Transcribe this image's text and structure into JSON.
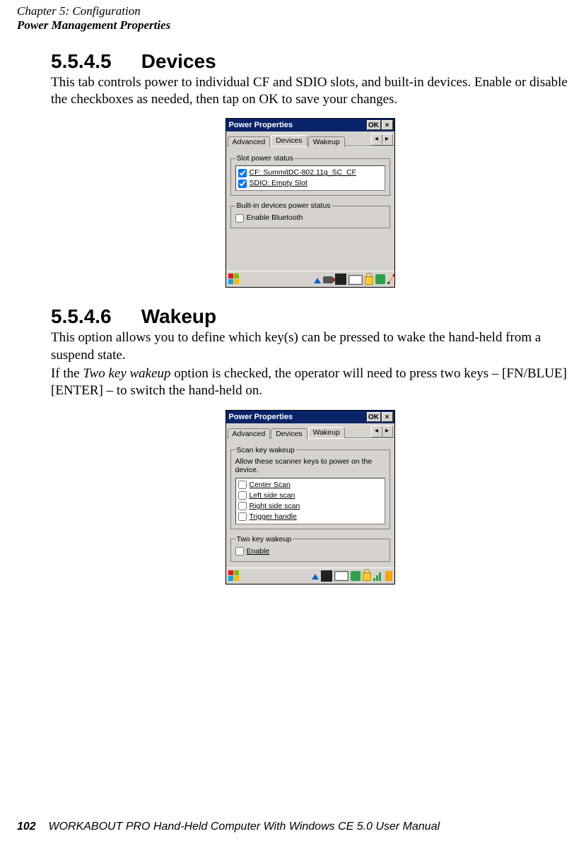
{
  "running_head": {
    "line1_prefix": "Chapter 5: ",
    "line1_title": "Configuration",
    "line2": "Power Management Properties"
  },
  "sections": {
    "devices": {
      "number": "5.5.4.5",
      "title": "Devices",
      "para": "This tab controls power to individual CF and SDIO slots, and built-in devices. Enable or disable the checkboxes as needed, then tap on OK to save your changes."
    },
    "wakeup": {
      "number": "5.5.4.6",
      "title": "Wakeup",
      "para1": "This option allows you to define which key(s) can be pressed to wake the hand-held from a suspend state.",
      "para2_pre": "If the ",
      "para2_ital": "Two key wakeup",
      "para2_post": " option is checked, the operator will need to press two keys – [FN/BLUE][ENTER] – to switch the hand-held on."
    }
  },
  "dialog_devices": {
    "title": "Power Properties",
    "ok": "OK",
    "tabs": {
      "advanced": "Advanced",
      "devices": "Devices",
      "wakeup": "Wakeup"
    },
    "group1_legend": "Slot power status",
    "slot_cf": "CF: SummitDC-802.11g_SC_CF",
    "slot_sdio": "SDIO: Empty Slot",
    "group2_legend": "Built-in devices power status",
    "bt_label": "Enable Bluetooth"
  },
  "dialog_wakeup": {
    "title": "Power Properties",
    "ok": "OK",
    "tabs": {
      "advanced": "Advanced",
      "devices": "Devices",
      "wakeup": "Wakeup"
    },
    "group1_legend": "Scan key wakeup",
    "hint": "Allow these scanner keys to power on the device.",
    "opts": {
      "center": "Center Scan",
      "left": "Left side scan",
      "right": "Right side scan",
      "trigger": "Trigger handle"
    },
    "group2_legend": "Two key wakeup",
    "enable": "Enable"
  },
  "footer": {
    "page_num": "102",
    "text": "WORKABOUT PRO Hand-Held Computer With Windows CE 5.0 User Manual"
  }
}
